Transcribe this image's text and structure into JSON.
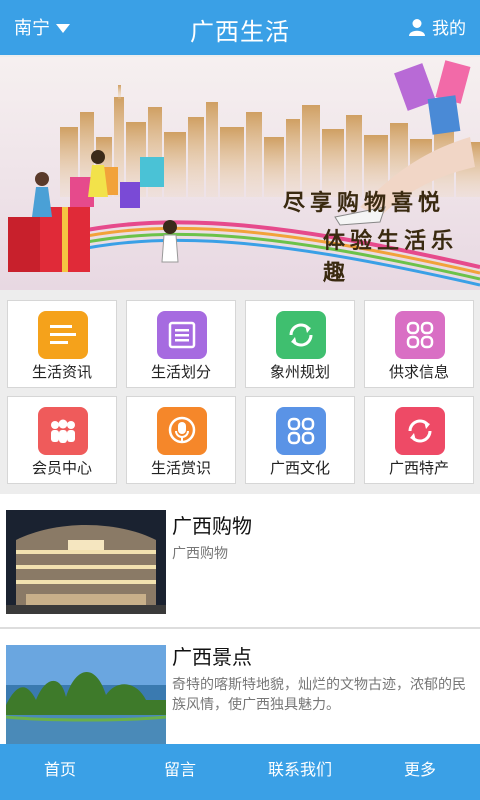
{
  "header": {
    "city": "南宁",
    "title": "广西生活",
    "mine": "我的"
  },
  "banner": {
    "line1": "尽享购物喜悦",
    "line2": "体验生活乐趣"
  },
  "grid": [
    {
      "label": "生活资讯",
      "icon": "news-icon",
      "color": "#f5a21b"
    },
    {
      "label": "生活划分",
      "icon": "list-icon",
      "color": "#a66be0"
    },
    {
      "label": "象州规划",
      "icon": "refresh-icon",
      "color": "#3fbf6f"
    },
    {
      "label": "供求信息",
      "icon": "grid-icon",
      "color": "#d96fc4"
    },
    {
      "label": "会员中心",
      "icon": "members-icon",
      "color": "#ef5b5b"
    },
    {
      "label": "生活赏识",
      "icon": "microphone-icon",
      "color": "#f5872a"
    },
    {
      "label": "广西文化",
      "icon": "grid-icon",
      "color": "#5a93e6"
    },
    {
      "label": "广西特产",
      "icon": "refresh-icon",
      "color": "#ee4a66"
    }
  ],
  "list": [
    {
      "title": "广西购物",
      "desc": "广西购物"
    },
    {
      "title": "广西景点",
      "desc": "奇特的喀斯特地貌，灿烂的文物古迹，浓郁的民族风情，使广西独具魅力。"
    }
  ],
  "tabs": [
    "首页",
    "留言",
    "联系我们",
    "更多"
  ]
}
